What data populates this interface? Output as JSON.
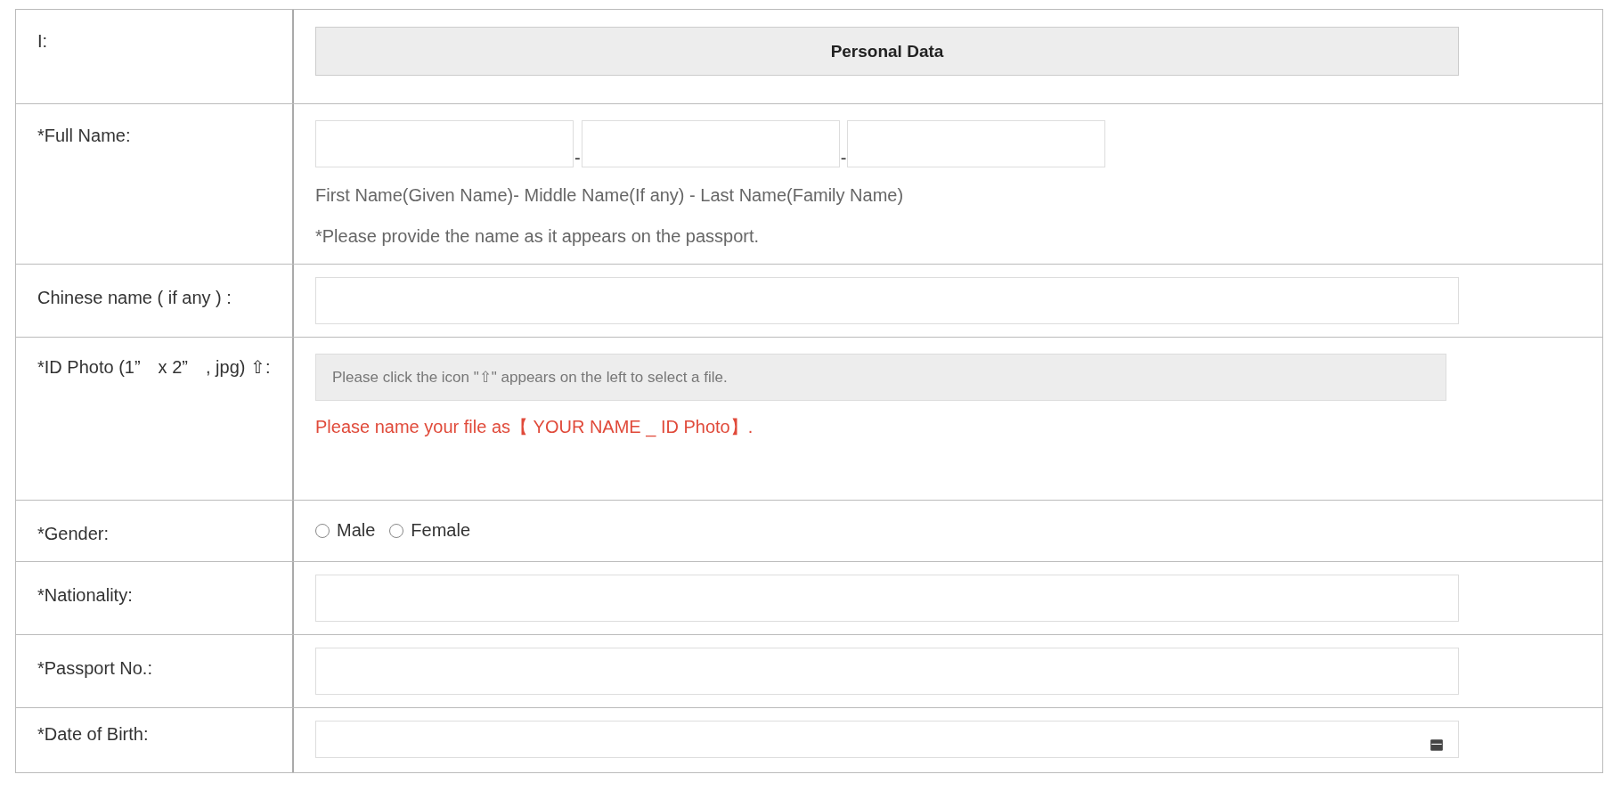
{
  "section": {
    "label": "I:",
    "title": "Personal Data"
  },
  "rows": [
    {
      "kind": "name",
      "label": "*Full Name:",
      "separators": [
        "-",
        "-"
      ],
      "caption": "First Name(Given Name)-  Middle Name(If any)   -  Last Name(Family Name)",
      "note": "*Please provide the name as it appears on the passport."
    },
    {
      "kind": "text",
      "label": "Chinese name ( if any ) :"
    },
    {
      "kind": "file",
      "label": "*ID Photo (1”　x 2”　, jpg) ⇧:",
      "placeholder": "Please click the icon \"⇧\" appears on the left to select a file.",
      "warning": "Please name your file as【 YOUR NAME _ ID Photo】."
    },
    {
      "kind": "radio",
      "label": "*Gender:",
      "options": [
        {
          "label": "Male",
          "selected": false
        },
        {
          "label": "Female",
          "selected": false
        }
      ]
    },
    {
      "kind": "text",
      "label": "*Nationality:"
    },
    {
      "kind": "text",
      "label": "*Passport No.:"
    },
    {
      "kind": "date",
      "label": "*Date of Birth:"
    }
  ]
}
